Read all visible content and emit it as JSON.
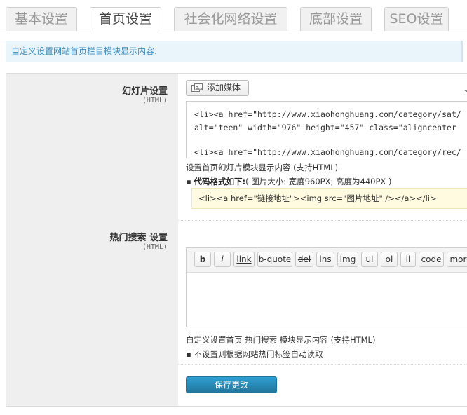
{
  "tabs": [
    {
      "label": "基本设置",
      "active": false
    },
    {
      "label": "首页设置",
      "active": true
    },
    {
      "label": "社会化网络设置",
      "active": false
    },
    {
      "label": "底部设置",
      "active": false
    },
    {
      "label": "SEO设置",
      "active": false
    }
  ],
  "notice": "自定义设置网站首页栏目模块显示内容.",
  "slides": {
    "title": "幻灯片设置",
    "sub": "(HTML)",
    "add_media": "添加媒体",
    "code_lines": [
      "<li><a href=\"http://www.xiaohonghuang.com/category/sat/",
      "alt=\"teen\" width=\"976\" height=\"457\" class=\"aligncenter",
      "<li><a href=\"http://www.xiaohonghuang.com/category/rec/"
    ],
    "desc": "设置首页幻灯片模块显示内容 (支持HTML)",
    "format_title": "代码格式如下:",
    "format_note": "( 图片大小: 宽度960PX; 高度为440PX )",
    "format_code": "<li><a href=\"链接地址\"><img src=\"图片地址\" /></a></li>"
  },
  "hot": {
    "title": "热门搜索 设置",
    "sub": "(HTML)",
    "toolbar": [
      "b",
      "i",
      "link",
      "b-quote",
      "del",
      "ins",
      "img",
      "ul",
      "ol",
      "li",
      "code",
      "more"
    ],
    "desc": "自定义设置首页 热门搜索 模块显示内容 (支持HTML)",
    "note": "不设置则根据网站热门标签自动读取"
  },
  "save_label": "保存更改",
  "colors": {
    "accent": "#21759b",
    "notice_bg": "#e9f5fb",
    "notice_text": "#3d8dbf",
    "code_bg": "#fffbe0"
  }
}
